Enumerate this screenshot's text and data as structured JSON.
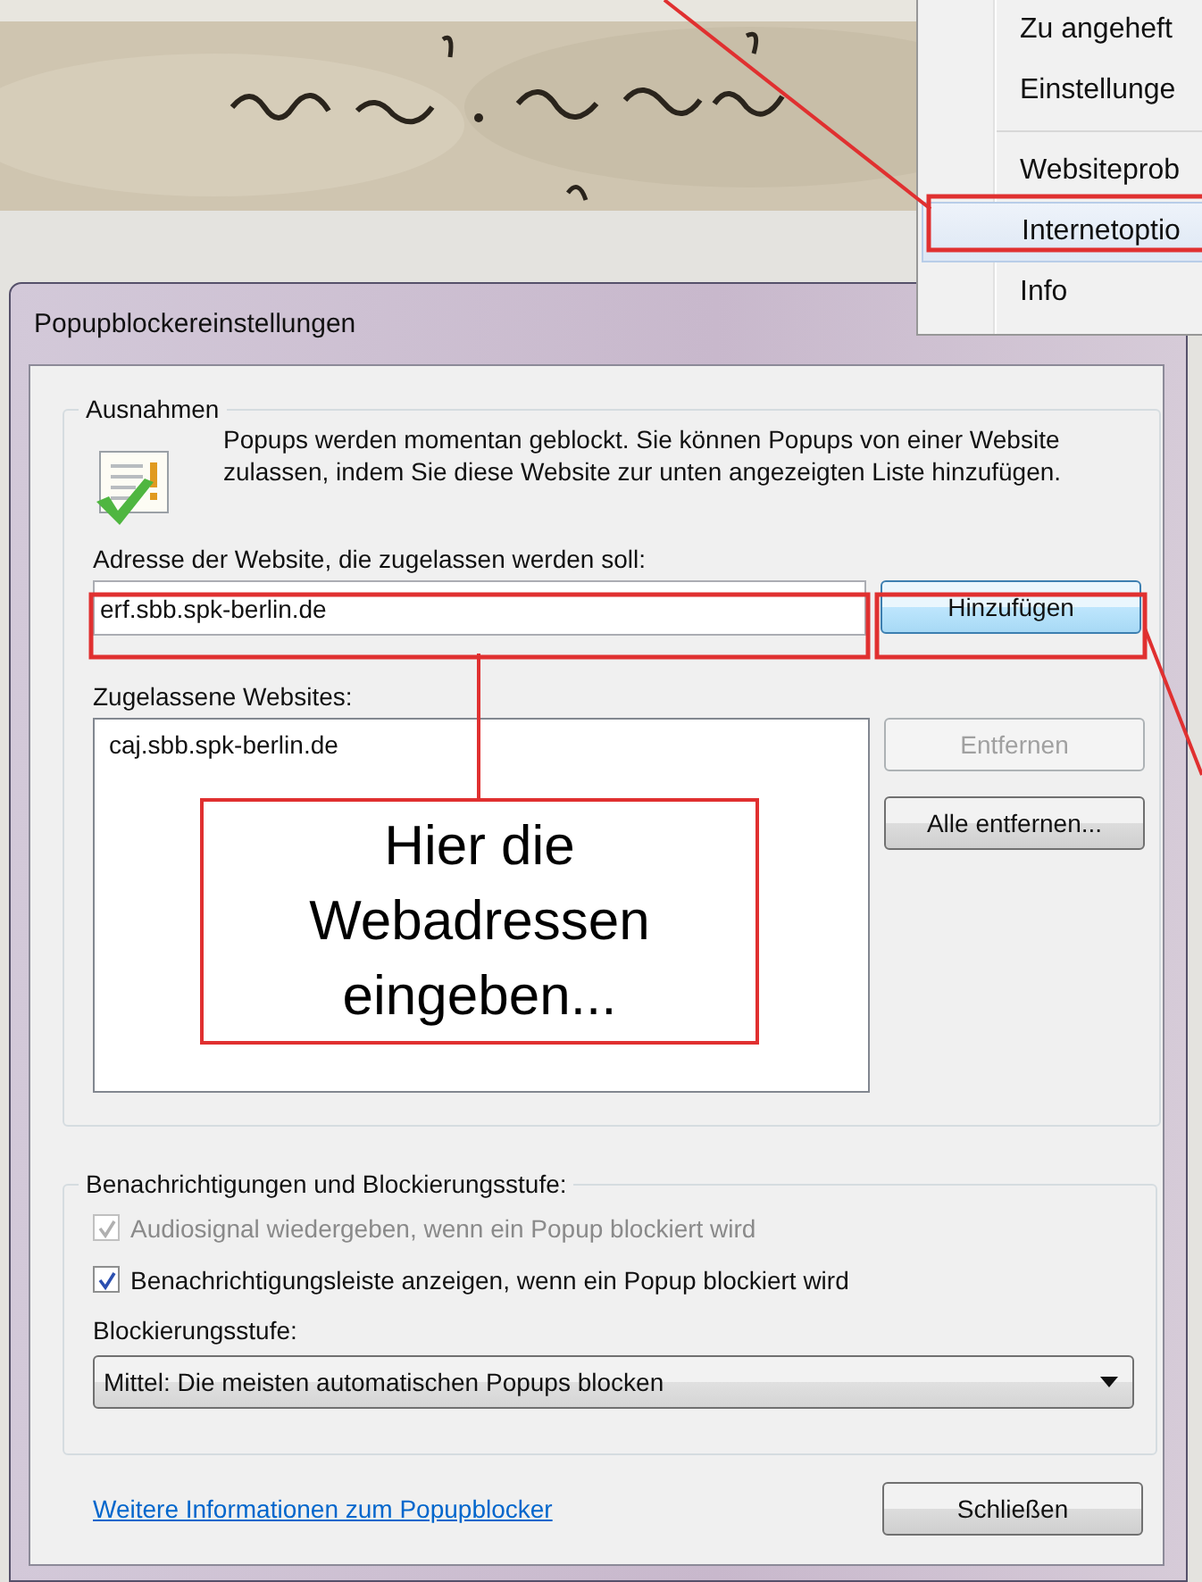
{
  "context_menu": {
    "groups": [
      [
        {
          "label": "Zu angeheft",
          "selected": false
        },
        {
          "label": "Einstellunge",
          "selected": false
        }
      ],
      [
        {
          "label": "Websiteprob",
          "selected": false
        },
        {
          "label": "Internetoptio",
          "selected": true
        },
        {
          "label": "Info",
          "selected": false
        }
      ]
    ]
  },
  "dialog": {
    "title": "Popupblockereinstellungen",
    "exceptions": {
      "legend": "Ausnahmen",
      "description": "Popups werden momentan geblockt. Sie können Popups von einer Website zulassen, indem Sie diese Website zur unten angezeigten Liste hinzufügen.",
      "address_label": "Adresse der Website, die zugelassen werden soll:",
      "address_value": "erf.sbb.spk-berlin.de",
      "add_button": "Hinzufügen",
      "allowed_label": "Zugelassene Websites:",
      "allowed_sites": [
        "caj.sbb.spk-berlin.de"
      ],
      "buttons": [
        {
          "label": "Entfernen",
          "disabled": true
        },
        {
          "label": "Alle entfernen...",
          "disabled": false
        }
      ]
    },
    "notifications": {
      "legend": "Benachrichtigungen und Blockierungsstufe:",
      "checkboxes": [
        {
          "label": "Audiosignal wiedergeben, wenn ein Popup blockiert wird",
          "checked": true,
          "disabled": true
        },
        {
          "label": "Benachrichtigungsleiste anzeigen, wenn ein Popup blockiert wird",
          "checked": true,
          "disabled": false
        }
      ],
      "level_label": "Blockierungsstufe:",
      "level_value": "Mittel: Die meisten automatischen Popups blocken"
    },
    "info_link": "Weitere Informationen zum Popupblocker",
    "close_button": "Schließen"
  },
  "annotation": {
    "callout": "Hier die Webadressen eingeben..."
  }
}
